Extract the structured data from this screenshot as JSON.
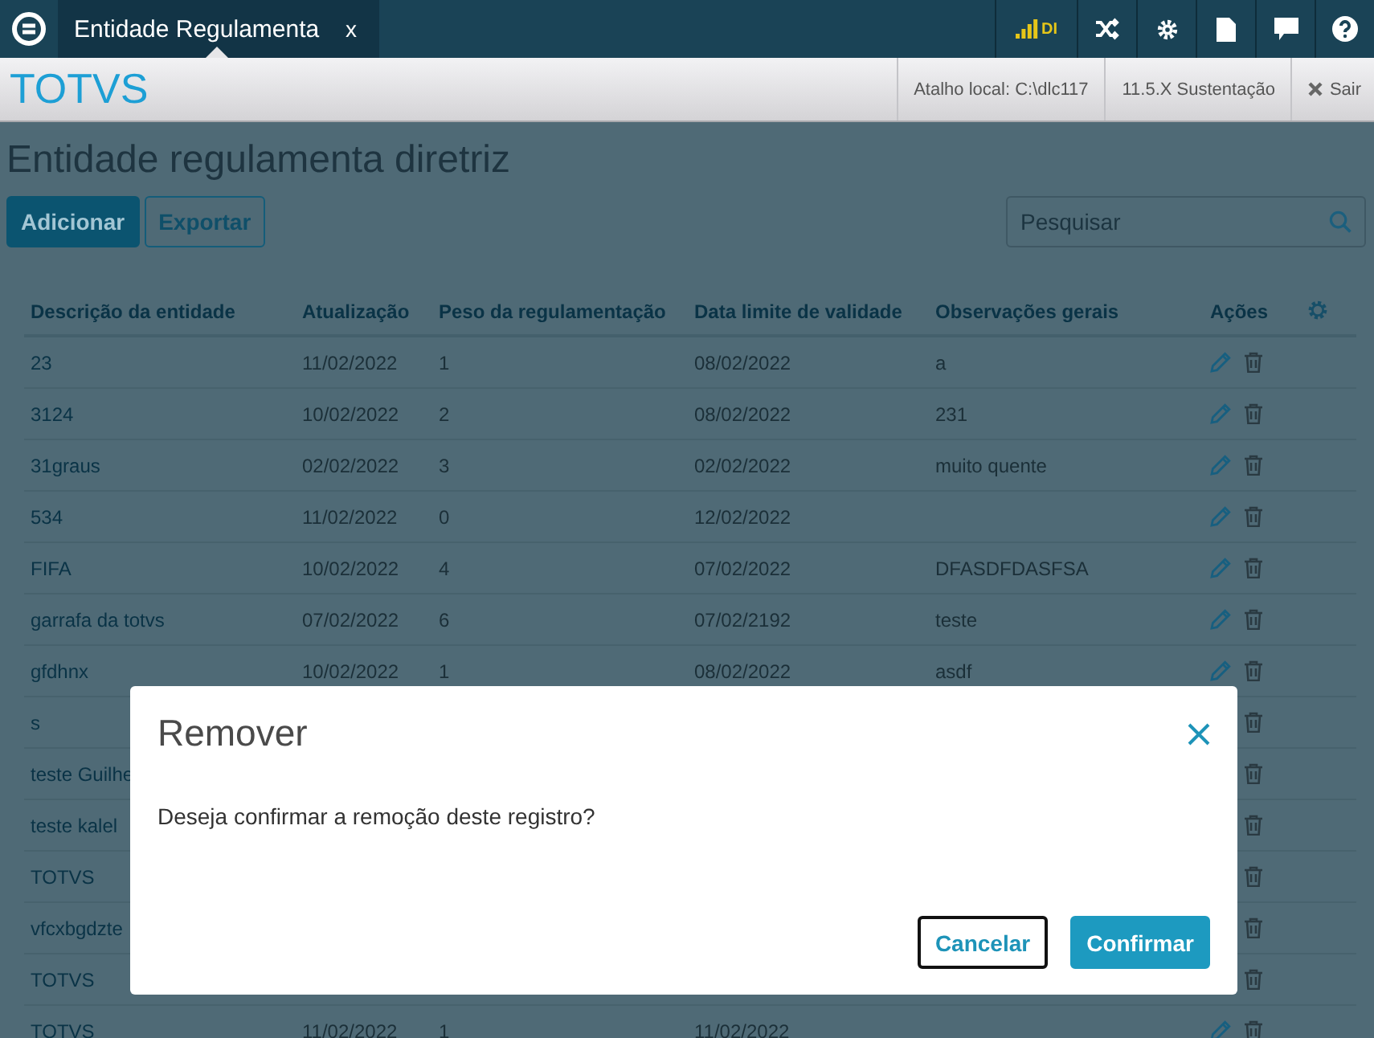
{
  "top_bar": {
    "tab": {
      "title": "Entidade Regulamenta",
      "close": "x",
      "selected": true
    },
    "signal": {
      "label": "DI"
    }
  },
  "header": {
    "brand": "TOTVS",
    "items": [
      "Atalho local: C:\\dlc117",
      "11.5.X Sustentação"
    ],
    "logout": "Sair"
  },
  "page": {
    "title": "Entidade regulamenta diretriz",
    "buttons": [
      {
        "label": "Adicionar",
        "kind": "primary"
      },
      {
        "label": "Exportar",
        "kind": "secondary"
      }
    ],
    "search": {
      "placeholder": "Pesquisar"
    }
  },
  "table": {
    "columns": [
      "Descrição da entidade",
      "Atualização",
      "Peso da regulamentação",
      "Data limite de validade",
      "Observações gerais",
      "Ações"
    ],
    "rows": [
      {
        "description": "23",
        "updated": "11/02/2022",
        "weight": "1",
        "deadline": "08/02/2022",
        "notes": "a",
        "actions": [
          {
            "kind": "edit"
          },
          {
            "kind": "delete"
          }
        ]
      },
      {
        "description": "3124",
        "updated": "10/02/2022",
        "weight": "2",
        "deadline": "08/02/2022",
        "notes": "231",
        "actions": [
          {
            "kind": "edit"
          },
          {
            "kind": "delete"
          }
        ]
      },
      {
        "description": "31graus",
        "updated": "02/02/2022",
        "weight": "3",
        "deadline": "02/02/2022",
        "notes": "muito quente",
        "actions": [
          {
            "kind": "edit"
          },
          {
            "kind": "delete"
          }
        ]
      },
      {
        "description": "534",
        "updated": "11/02/2022",
        "weight": "0",
        "deadline": "12/02/2022",
        "actions": [
          {
            "kind": "edit"
          },
          {
            "kind": "delete"
          }
        ]
      },
      {
        "description": "FIFA",
        "updated": "10/02/2022",
        "weight": "4",
        "deadline": "07/02/2022",
        "notes": "DFASDFDASFSA",
        "actions": [
          {
            "kind": "edit"
          },
          {
            "kind": "delete"
          }
        ]
      },
      {
        "description": "garrafa da totvs",
        "updated": "07/02/2022",
        "weight": "6",
        "deadline": "07/02/2192",
        "notes": "teste",
        "actions": [
          {
            "kind": "edit"
          },
          {
            "kind": "delete"
          }
        ]
      },
      {
        "description": "gfdhnx",
        "updated": "10/02/2022",
        "weight": "1",
        "deadline": "08/02/2022",
        "notes": "asdf",
        "actions": [
          {
            "kind": "edit"
          },
          {
            "kind": "delete"
          }
        ]
      },
      {
        "description": "s",
        "actions": [
          {
            "kind": "delete"
          }
        ]
      },
      {
        "description": "teste Guilhe",
        "actions": [
          {
            "kind": "delete"
          }
        ]
      },
      {
        "description": "teste kalel",
        "actions": [
          {
            "kind": "delete"
          }
        ]
      },
      {
        "description": "TOTVS",
        "actions": [
          {
            "kind": "delete"
          }
        ]
      },
      {
        "description": "vfcxbgdzte",
        "actions": [
          {
            "kind": "delete"
          }
        ]
      },
      {
        "description": "TOTVS",
        "actions": [
          {
            "kind": "delete"
          }
        ]
      },
      {
        "description": "TOTVS",
        "updated": "11/02/2022",
        "weight": "1",
        "deadline": "11/02/2022",
        "actions": [
          {
            "kind": "edit"
          },
          {
            "kind": "delete"
          }
        ]
      }
    ]
  },
  "dialog": {
    "title": "Remover",
    "message": "Deseja confirmar a remoção deste registro?",
    "buttons": [
      {
        "label": "Cancelar",
        "kind": "secondary",
        "focused": true
      },
      {
        "label": "Confirmar",
        "kind": "primary",
        "focused": false
      }
    ]
  }
}
